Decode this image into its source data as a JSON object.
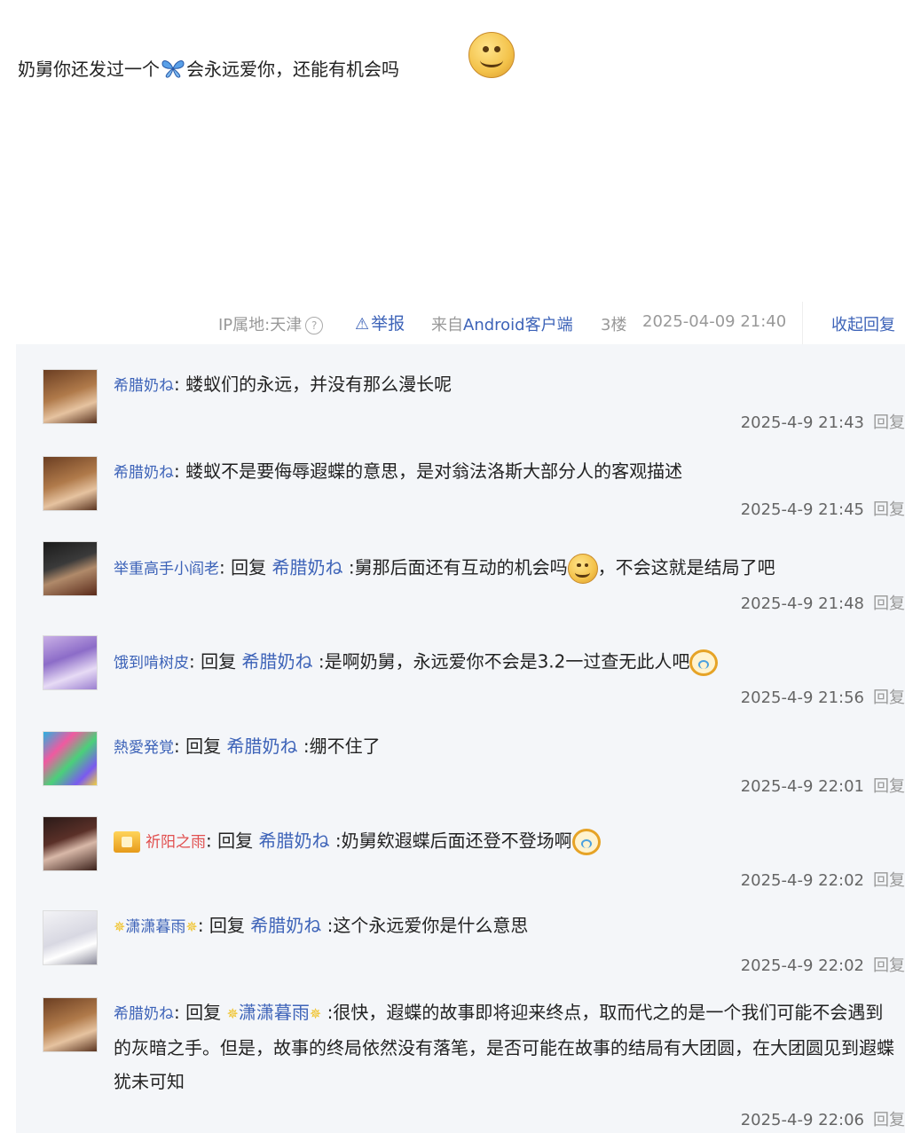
{
  "post": {
    "text_before": "奶舅你还发过一个",
    "butterfly_icon": "butterfly-emoji",
    "text_after": "会永远爱你，还能有机会吗",
    "emoji": "smile-emoji"
  },
  "meta": {
    "ip": "IP属地:天津",
    "help": "?",
    "report": "举报",
    "source_prefix": "来自",
    "source_client": "Android客户端",
    "floor": "3楼",
    "time": "2025-04-09 21:40",
    "collapse": "收起回复"
  },
  "replies": [
    {
      "user": "希腊奶ね",
      "sep": ":",
      "reply_to": "",
      "text": " 蝼蚁们的永远，并没有那么漫长呢",
      "time": "2025-4-9 21:43",
      "action": "回复"
    },
    {
      "user": "希腊奶ね",
      "sep": ":",
      "reply_to": "",
      "text": " 蝼蚁不是要侮辱遐蝶的意思，是对翁法洛斯大部分人的客观描述",
      "time": "2025-4-9 21:45",
      "action": "回复"
    },
    {
      "user": "举重高手小阎老",
      "sep": ": ",
      "reply_word": "回复",
      "reply_to": "希腊奶ね",
      "text": " :舅那后面还有互动的机会吗",
      "text2": "，不会这就是结局了吧",
      "time": "2025-4-9 21:48",
      "action": "回复"
    },
    {
      "user": "饿到啃树皮",
      "sep": ": ",
      "reply_word": "回复",
      "reply_to": "希腊奶ね",
      "text": " :是啊奶舅，永远爱你不会是3.2一过查无此人吧",
      "time": "2025-4-9 21:56",
      "action": "回复"
    },
    {
      "user": "熱愛発覚",
      "sep": ": ",
      "reply_word": "回复",
      "reply_to": "希腊奶ね",
      "text": " :绷不住了",
      "time": "2025-4-9 22:01",
      "action": "回复"
    },
    {
      "user": "祈阳之雨",
      "sep": ": ",
      "reply_word": "回复",
      "reply_to": "希腊奶ね",
      "text": " :奶舅欸遐蝶后面还登不登场啊",
      "time": "2025-4-9 22:02",
      "action": "回复"
    },
    {
      "user": "潇潇暮雨",
      "sep": ": ",
      "reply_word": "回复",
      "reply_to": "希腊奶ね",
      "text": " :这个永远爱你是什么意思",
      "time": "2025-4-9 22:02",
      "action": "回复"
    },
    {
      "user": "希腊奶ね",
      "sep": ": ",
      "reply_word": "回复",
      "reply_to": "潇潇暮雨",
      "text": " :很快，遐蝶的故事即将迎来终点，取而代之的是一个我们可能不会遇到的灰暗之手。但是，故事的终局依然没有落笔，是否可能在故事的结局有大团圆，在大团圆见到遐蝶犹未可知",
      "time": "2025-4-9 22:06",
      "action": "回复"
    }
  ]
}
